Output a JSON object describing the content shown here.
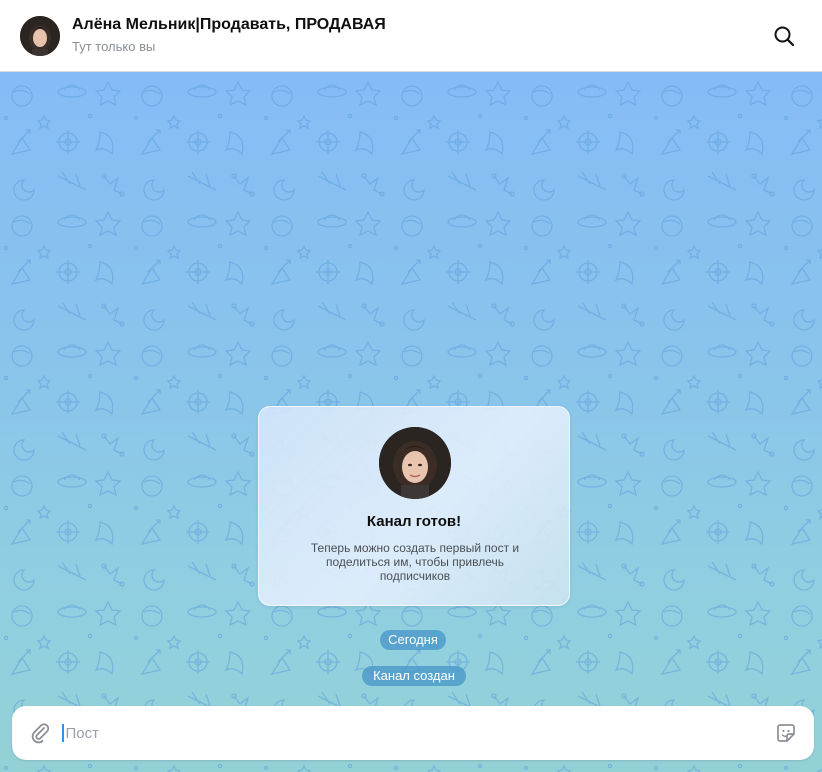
{
  "header": {
    "title": "Алёна Мельник|Продавать, ПРОДАВАЯ",
    "subtitle": "Тут только вы",
    "search_icon": "search-icon"
  },
  "service_card": {
    "title": "Канал готов!",
    "body": "Теперь можно создать первый пост и поделиться им, чтобы привлечь подписчиков"
  },
  "service_messages": {
    "date": "Сегодня",
    "created": "Канал создан"
  },
  "composer": {
    "placeholder": "Пост",
    "value": "",
    "attach_icon": "paperclip-icon",
    "sticker_icon": "sticker-icon"
  },
  "colors": {
    "accent": "#3390ec",
    "pill": "#4696c8",
    "chat_top": "#86bcf6",
    "chat_bottom": "#93d1d6"
  }
}
